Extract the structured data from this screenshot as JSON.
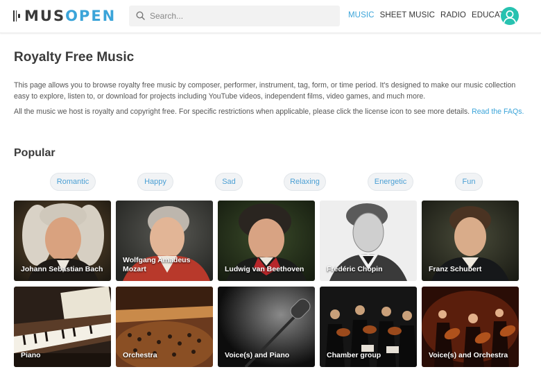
{
  "header": {
    "logo": {
      "part1": "MUS",
      "part2": "OPEN"
    },
    "search": {
      "placeholder": "Search..."
    },
    "nav": [
      {
        "label": "MUSIC",
        "active": true
      },
      {
        "label": "SHEET MUSIC",
        "active": false
      },
      {
        "label": "RADIO",
        "active": false
      },
      {
        "label": "EDUCATION",
        "active": false
      }
    ],
    "icons": {
      "search": "search-icon",
      "avatar": "user-avatar-icon"
    }
  },
  "main": {
    "title": "Royalty Free Music",
    "intro1": "This page allows you to browse royalty free music by composer, performer, instrument, tag, form, or time period. It's designed to make our music collection easy to explore, listen to, or download for projects including YouTube videos, independent films, video games, and much more.",
    "intro2": "All the music we host is royalty and copyright free. For specific restrictions when applicable, please click the license icon to see more details.",
    "faq_link": "Read the FAQs.",
    "popular_heading": "Popular",
    "tags": [
      "Romantic",
      "Happy",
      "Sad",
      "Relaxing",
      "Energetic",
      "Fun"
    ],
    "composers": [
      "Johann Sebastian Bach",
      "Wolfgang Amadeus Mozart",
      "Ludwig van Beethoven",
      "Frédéric Chopin",
      "Franz Schubert"
    ],
    "instruments": [
      "Piano",
      "Orchestra",
      "Voice(s) and Piano",
      "Chamber group",
      "Voice(s) and Orchestra"
    ]
  },
  "colors": {
    "accent": "#3ba4d9",
    "avatar": "#27c2b0",
    "tag_bg": "#f1f3f5"
  }
}
